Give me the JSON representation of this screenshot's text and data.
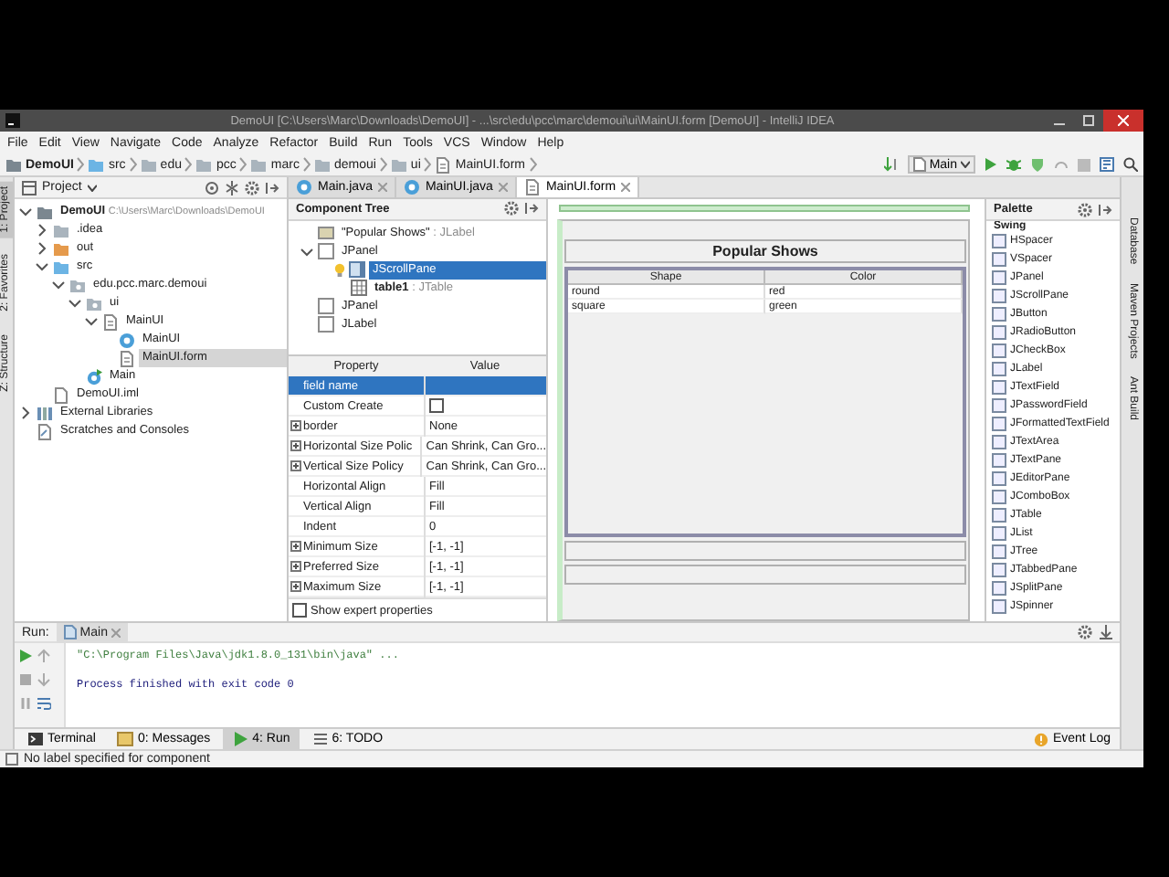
{
  "window": {
    "title": "DemoUI [C:\\Users\\Marc\\Downloads\\DemoUI] - ...\\src\\edu\\pcc\\marc\\demoui\\ui\\MainUI.form [DemoUI] - IntelliJ IDEA"
  },
  "menu": [
    "File",
    "Edit",
    "View",
    "Navigate",
    "Code",
    "Analyze",
    "Refactor",
    "Build",
    "Run",
    "Tools",
    "VCS",
    "Window",
    "Help"
  ],
  "breadcrumbs": [
    {
      "label": "DemoUI",
      "kind": "project"
    },
    {
      "label": "src",
      "kind": "source-folder"
    },
    {
      "label": "edu",
      "kind": "folder"
    },
    {
      "label": "pcc",
      "kind": "folder"
    },
    {
      "label": "marc",
      "kind": "folder"
    },
    {
      "label": "demoui",
      "kind": "folder"
    },
    {
      "label": "ui",
      "kind": "folder"
    },
    {
      "label": "MainUI.form",
      "kind": "form"
    }
  ],
  "run_config": {
    "label": "Main"
  },
  "editor_tabs": [
    {
      "label": "Main.java",
      "kind": "class",
      "selected": false
    },
    {
      "label": "MainUI.java",
      "kind": "class",
      "selected": false
    },
    {
      "label": "MainUI.form",
      "kind": "form",
      "selected": true
    }
  ],
  "left_tool_strip": [
    {
      "label": "1: Project",
      "selected": true
    },
    {
      "label": "2: Favorites",
      "selected": false
    },
    {
      "label": "Z: Structure",
      "selected": false
    }
  ],
  "project_panel": {
    "title": "Project",
    "tree": [
      {
        "label": "DemoUI",
        "path": "C:\\Users\\Marc\\Downloads\\DemoUI",
        "kind": "project",
        "expanded": true,
        "selected": false,
        "children": [
          {
            "label": ".idea",
            "kind": "folder",
            "expanded": false,
            "selected": false
          },
          {
            "label": "out",
            "kind": "excluded-folder",
            "expanded": false,
            "selected": false
          },
          {
            "label": "src",
            "kind": "source-folder",
            "expanded": true,
            "selected": false,
            "children": [
              {
                "label": "edu.pcc.marc.demoui",
                "kind": "package",
                "expanded": true,
                "selected": false,
                "children": [
                  {
                    "label": "ui",
                    "kind": "package",
                    "expanded": true,
                    "selected": false,
                    "children": [
                      {
                        "label": "MainUI",
                        "kind": "form-group",
                        "expanded": true,
                        "selected": false,
                        "children": [
                          {
                            "label": "MainUI",
                            "kind": "class",
                            "selected": false
                          },
                          {
                            "label": "MainUI.form",
                            "kind": "form",
                            "selected": true
                          }
                        ]
                      }
                    ]
                  },
                  {
                    "label": "Main",
                    "kind": "main-class",
                    "selected": false
                  }
                ]
              }
            ]
          },
          {
            "label": "DemoUI.iml",
            "kind": "module-file",
            "selected": false
          }
        ]
      },
      {
        "label": "External Libraries",
        "kind": "libraries",
        "expanded": false,
        "selected": false
      },
      {
        "label": "Scratches and Consoles",
        "kind": "scratches",
        "selected": false
      }
    ]
  },
  "component_tree": {
    "title": "Component Tree",
    "items": [
      {
        "name": "\"Popular Shows\"",
        "type": ": JLabel",
        "kind": "label",
        "selected": false
      },
      {
        "name": "JPanel",
        "kind": "panel",
        "expanded": true,
        "selected": false,
        "children": [
          {
            "name": "JScrollPane",
            "kind": "scroll-pane",
            "intention_bulb": true,
            "selected": true,
            "children": [
              {
                "name": "**table1**",
                "type": ": JTable",
                "kind": "table",
                "selected": false
              }
            ]
          }
        ]
      },
      {
        "name": "JPanel",
        "kind": "panel",
        "selected": false
      },
      {
        "name": "JLabel",
        "kind": "panel",
        "selected": false
      }
    ]
  },
  "properties": {
    "columns": [
      "Property",
      "Value"
    ],
    "rows": [
      {
        "name": "field name",
        "kind": "text",
        "expandable": false,
        "selected": true
      },
      {
        "name": "Custom Create",
        "kind": "checkbox",
        "checked": false,
        "expandable": false,
        "selected": false
      },
      {
        "name": "border",
        "value": "None",
        "kind": "text",
        "expandable": true,
        "selected": false
      },
      {
        "name": "Horizontal Size Polic",
        "value": "Can Shrink, Can Gro...",
        "kind": "text",
        "expandable": true,
        "selected": false
      },
      {
        "name": "Vertical Size Policy",
        "value": "Can Shrink, Can Gro...",
        "kind": "text",
        "expandable": true,
        "selected": false
      },
      {
        "name": "Horizontal Align",
        "value": "Fill",
        "kind": "text",
        "expandable": false,
        "selected": false
      },
      {
        "name": "Vertical Align",
        "value": "Fill",
        "kind": "text",
        "expandable": false,
        "selected": false
      },
      {
        "name": "Indent",
        "value": "0",
        "kind": "text",
        "expandable": false,
        "selected": false
      },
      {
        "name": "Minimum Size",
        "value": "[-1, -1]",
        "kind": "text",
        "expandable": true,
        "selected": false
      },
      {
        "name": "Preferred Size",
        "value": "[-1, -1]",
        "kind": "text",
        "expandable": true,
        "selected": false
      },
      {
        "name": "Maximum Size",
        "value": "[-1, -1]",
        "kind": "text",
        "expandable": true,
        "selected": false
      }
    ],
    "expert": {
      "label": "Show expert properties",
      "checked": false
    }
  },
  "form": {
    "title": "Popular Shows",
    "table": {
      "columns": [
        "Shape",
        "Color"
      ],
      "rows": [
        [
          "round",
          "red"
        ],
        [
          "square",
          "green"
        ]
      ]
    }
  },
  "palette": {
    "title": "Palette",
    "group": "Swing",
    "items": [
      "HSpacer",
      "VSpacer",
      "JPanel",
      "JScrollPane",
      "JButton",
      "JRadioButton",
      "JCheckBox",
      "JLabel",
      "JTextField",
      "JPasswordField",
      "JFormattedTextField",
      "JTextArea",
      "JTextPane",
      "JEditorPane",
      "JComboBox",
      "JTable",
      "JList",
      "JTree",
      "JTabbedPane",
      "JSplitPane",
      "JSpinner"
    ]
  },
  "right_tool_strip": [
    "Database",
    "Maven Projects",
    "Ant Build"
  ],
  "run_panel": {
    "label": "Run:",
    "tab": "Main",
    "lines": [
      {
        "text": "\"C:\\Program Files\\Java\\jdk1.8.0_131\\bin\\java\" ...",
        "kind": "command"
      },
      {
        "text": "Process finished with exit code 0",
        "kind": "output"
      }
    ]
  },
  "tool_tabs": [
    {
      "label": "Terminal",
      "kind": "terminal",
      "selected": false
    },
    {
      "label": "0: Messages",
      "kind": "messages",
      "selected": false
    },
    {
      "label": "4: Run",
      "kind": "run",
      "selected": true
    },
    {
      "label": "6: TODO",
      "kind": "todo",
      "selected": false
    }
  ],
  "event_log": {
    "label": "Event Log"
  },
  "status_bar": {
    "message": "No label specified for component"
  }
}
